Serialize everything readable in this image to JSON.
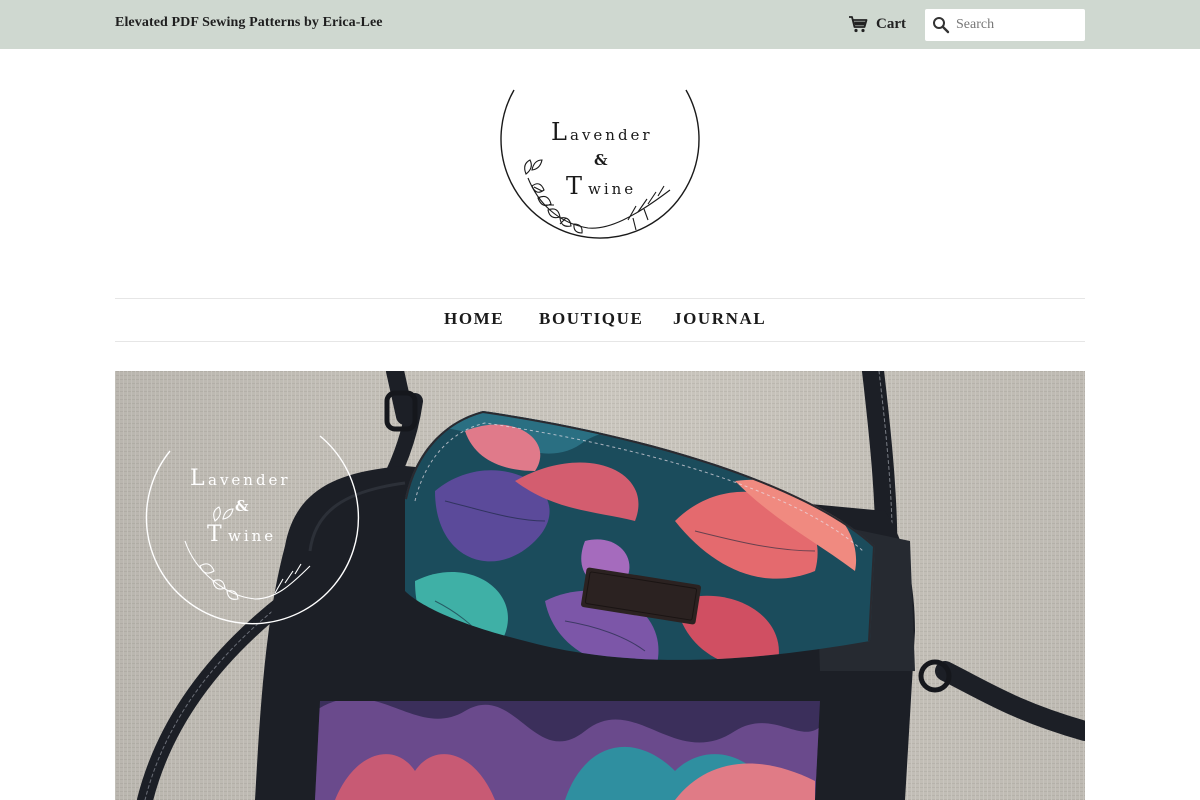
{
  "announcement": {
    "tagline": "Elevated PDF Sewing Patterns by Erica-Lee",
    "cart_label": "Cart",
    "search_placeholder": "Search",
    "search_value": ""
  },
  "logo": {
    "line1": "avender",
    "line1_initial": "L",
    "ampersand": "&",
    "line2": "wine",
    "line2_initial": "T"
  },
  "nav": {
    "items": [
      {
        "label": "HOME"
      },
      {
        "label": "BOUTIQUE"
      },
      {
        "label": "JOURNAL"
      }
    ]
  },
  "hero": {
    "watermark_line1": "avender",
    "watermark_line1_initial": "L",
    "watermark_ampersand": "&",
    "watermark_line2": "wine",
    "watermark_line2_initial": "T"
  },
  "colors": {
    "announcement_bar": "#cfd8d0",
    "nav_border": "#e6e6e6",
    "bag_body": "#1c1f26",
    "linen_background": "#c9c5bd"
  }
}
